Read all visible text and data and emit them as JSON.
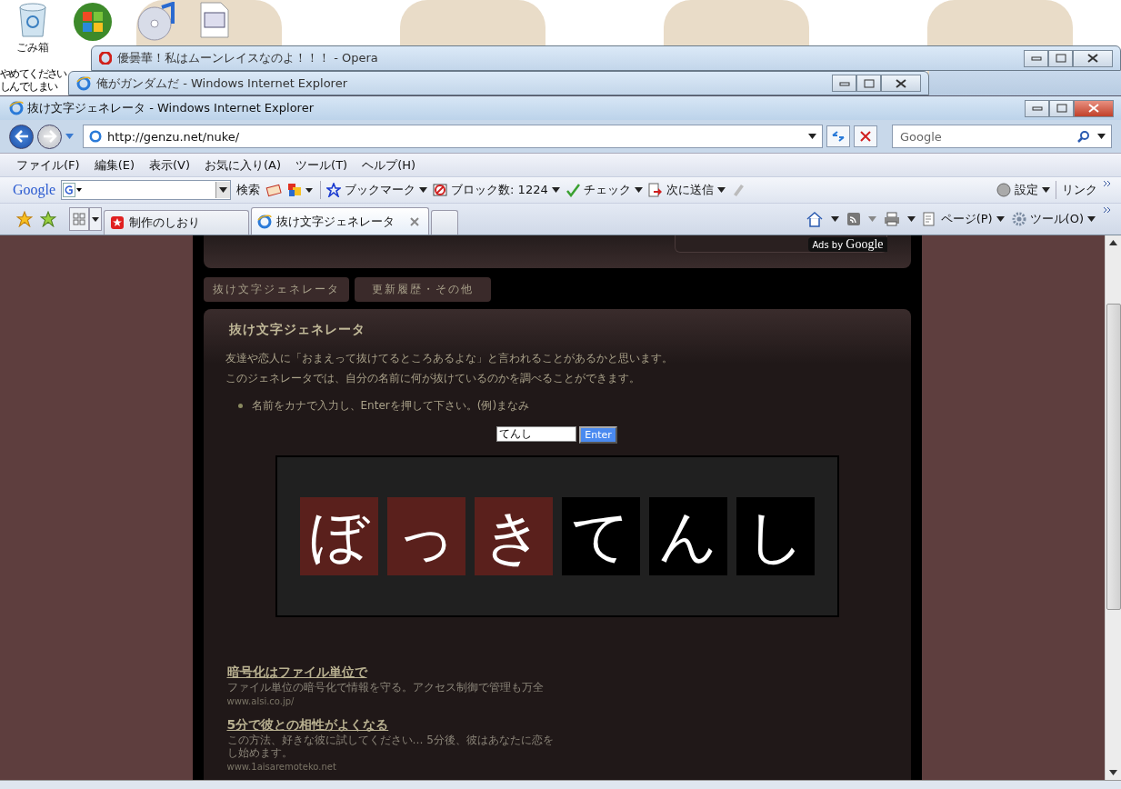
{
  "desktop": {
    "icons": [
      {
        "kind": "trash",
        "label": "ごみ箱"
      },
      {
        "kind": "orb"
      },
      {
        "kind": "disc"
      },
      {
        "kind": "document"
      }
    ],
    "note_lines": [
      "やめてください",
      "しんでしまい"
    ]
  },
  "background_windows": [
    {
      "kind": "opera",
      "title": "優曇華！私はムーンレイスなのよ！！！ - Opera"
    },
    {
      "kind": "ie",
      "title": "俺がガンダムだ - Windows Internet Explorer"
    }
  ],
  "window": {
    "title": "抜け文字ジェネレータ - Windows Internet Explorer"
  },
  "address_bar": {
    "url": "http://genzu.net/nuke/"
  },
  "search_box": {
    "placeholder": "Google"
  },
  "menu": [
    "ファイル(F)",
    "編集(E)",
    "表示(V)",
    "お気に入り(A)",
    "ツール(T)",
    "ヘルプ(H)"
  ],
  "google_toolbar": {
    "logo": "Google",
    "search_button": "検索",
    "items": [
      {
        "kind": "bookmark",
        "label": "ブックマーク"
      },
      {
        "kind": "block",
        "label": "ブロック数: 1224"
      },
      {
        "kind": "check",
        "label": "チェック"
      },
      {
        "kind": "send",
        "label": "次に送信"
      }
    ],
    "settings": "設定",
    "links": "リンク"
  },
  "tabs": [
    {
      "label": "制作のしおり",
      "selected": false
    },
    {
      "label": "抜け文字ジェネレータ",
      "selected": true
    }
  ],
  "command_bar": [
    "ページ(P)",
    "ツール(O)"
  ],
  "page": {
    "ads_badge": {
      "prefix": "Ads by",
      "brand": "Google"
    },
    "nav": [
      {
        "label": "抜け文字ジェネレータ"
      },
      {
        "label": "更新履歴・その他"
      }
    ],
    "heading": "抜け文字ジェネレータ",
    "paragraphs": [
      "友達や恋人に「おまえって抜けてるところあるよな」と言われることがあるかと思います。",
      "このジェネレータでは、自分の名前に何が抜けているのかを調べることができます。"
    ],
    "bullets": [
      "名前をカナで入力し、Enterを押して下さい。(例)まなみ"
    ],
    "name_input": {
      "value": "てんし"
    },
    "submit_button": "Enter",
    "result": [
      {
        "char": "ぼ",
        "highlighted": true
      },
      {
        "char": "っ",
        "highlighted": true
      },
      {
        "char": "き",
        "highlighted": true
      },
      {
        "char": "て",
        "highlighted": false
      },
      {
        "char": "ん",
        "highlighted": false
      },
      {
        "char": "し",
        "highlighted": false
      }
    ],
    "ads": [
      {
        "title": "暗号化はファイル単位で",
        "lines": [
          "ファイル単位の暗号化で情報を守る。アクセス制御で管理も万全"
        ],
        "url": "www.alsi.co.jp/"
      },
      {
        "title": "5分で彼との相性がよくなる",
        "lines": [
          "この方法、好きな彼に試してください… 5分後、彼はあなたに恋を",
          "し始めます。"
        ],
        "url": "www.1aisaremoteko.net"
      }
    ]
  }
}
